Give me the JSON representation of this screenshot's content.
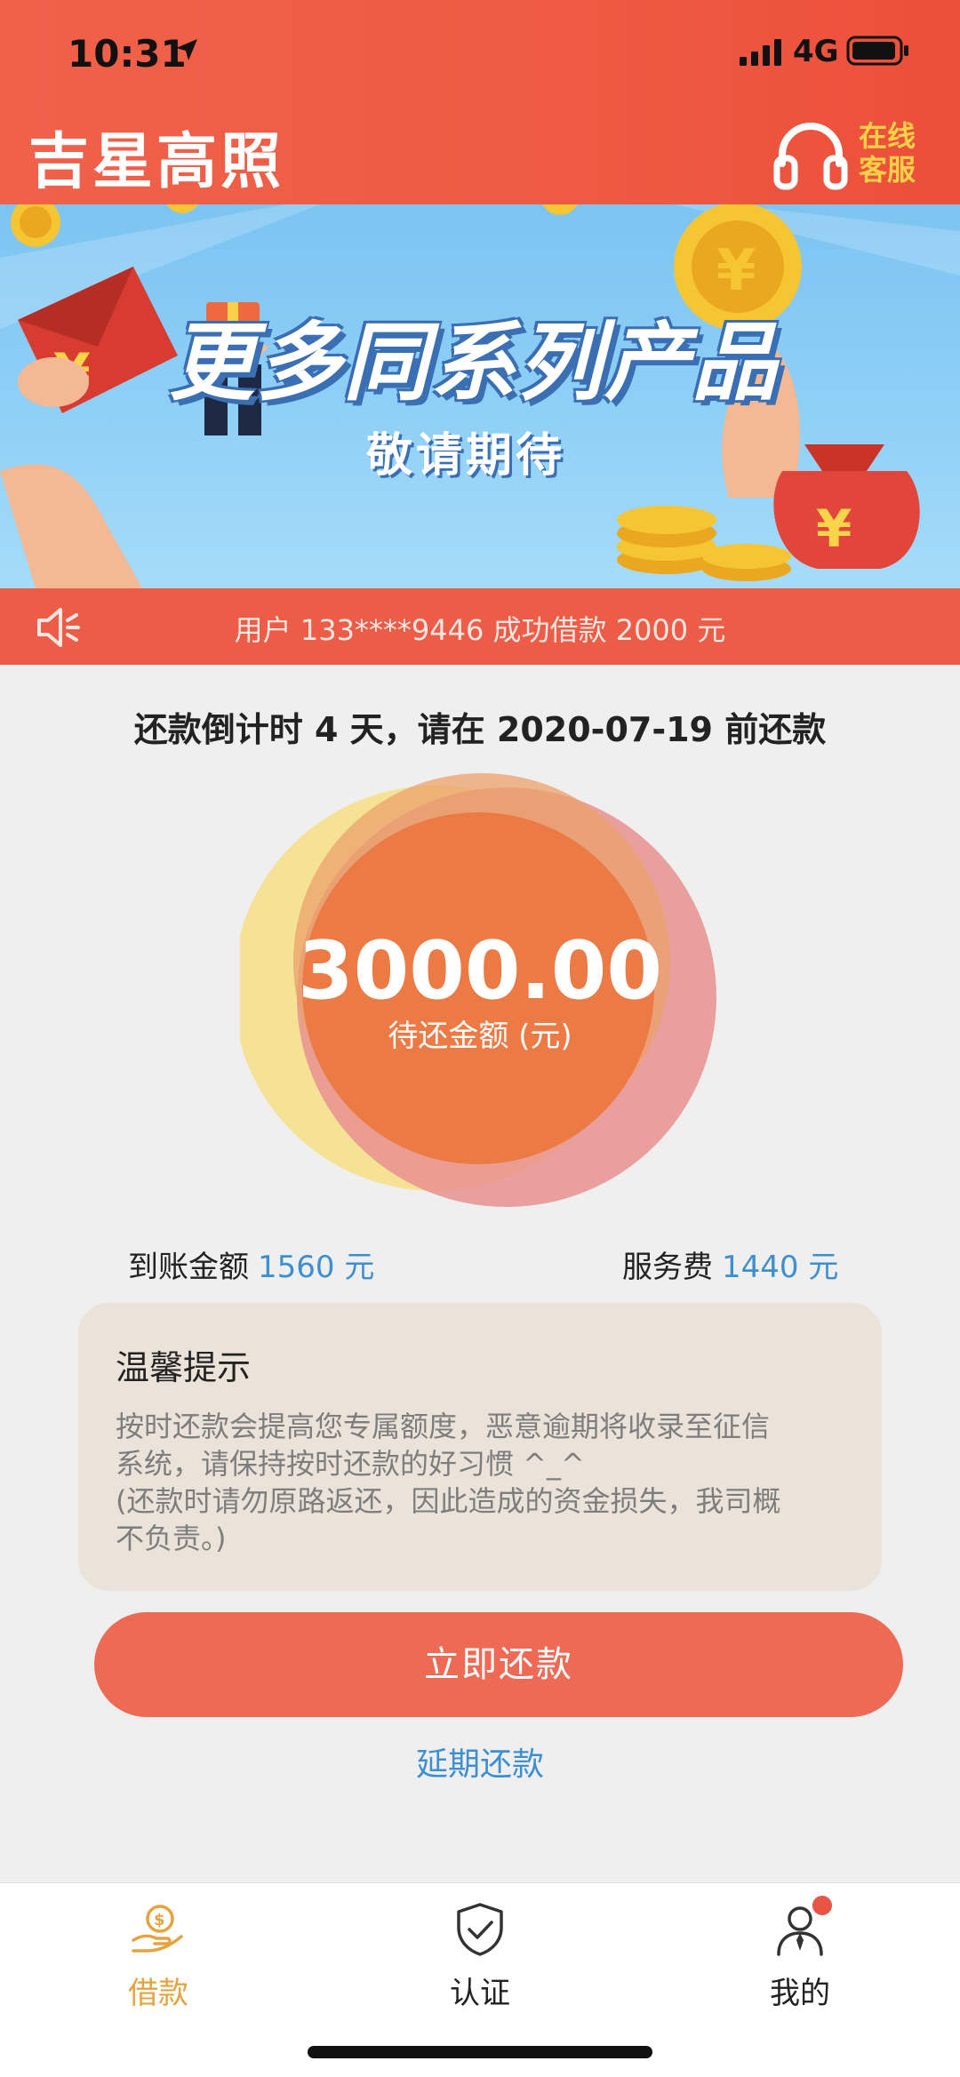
{
  "status_bar": {
    "time": "10:31",
    "network": "4G"
  },
  "header": {
    "title": "吉星高照",
    "customer_service_label": "在线客服"
  },
  "banner": {
    "title": "更多同系列产品",
    "subtitle": "敬请期待"
  },
  "notice": {
    "text": "用户 133****9446 成功借款 2000 元"
  },
  "repayment": {
    "countdown": "还款倒计时 4 天，请在 2020-07-19 前还款",
    "amount": "3000.00",
    "amount_label": "待还金额 (元)",
    "received_label": "到账金额",
    "received_value": "1560 元",
    "fee_label": "服务费",
    "fee_value": "1440 元"
  },
  "tips": {
    "title": "温馨提示",
    "lines": [
      "按时还款会提高您专属额度，恶意逾期将收录至征信",
      "系统，请保持按时还款的好习惯 ^_^",
      "(还款时请勿原路返还，因此造成的资金损失，我司概",
      "不负责。)"
    ]
  },
  "actions": {
    "pay_now": "立即还款",
    "delay": "延期还款"
  },
  "tabbar": {
    "items": [
      {
        "label": "借款",
        "icon": "money-hand-icon",
        "active": true
      },
      {
        "label": "认证",
        "icon": "shield-check-icon",
        "active": false
      },
      {
        "label": "我的",
        "icon": "person-icon",
        "active": false
      }
    ]
  },
  "colors": {
    "brand_red": "#ee5a43",
    "accent_gold": "#e7a33d",
    "link_blue": "#3e8fd0",
    "circle_orange": "#ec7a45"
  }
}
